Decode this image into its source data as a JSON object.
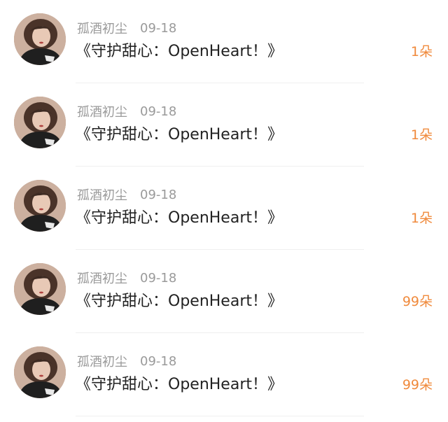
{
  "gifts": [
    {
      "user": "孤酒初尘",
      "date": "09-18",
      "title": "《守护甜心：OpenHeart！》",
      "count": "1朵"
    },
    {
      "user": "孤酒初尘",
      "date": "09-18",
      "title": "《守护甜心：OpenHeart！》",
      "count": "1朵"
    },
    {
      "user": "孤酒初尘",
      "date": "09-18",
      "title": "《守护甜心：OpenHeart！》",
      "count": "1朵"
    },
    {
      "user": "孤酒初尘",
      "date": "09-18",
      "title": "《守护甜心：OpenHeart！》",
      "count": "99朵"
    },
    {
      "user": "孤酒初尘",
      "date": "09-18",
      "title": "《守护甜心：OpenHeart！》",
      "count": "99朵"
    }
  ],
  "colors": {
    "accent": "#f08a3c",
    "meta_text": "#9a9a9a",
    "title_text": "#222222",
    "divider": "#efefef"
  },
  "icons": {
    "avatar": "user-avatar-photo"
  }
}
